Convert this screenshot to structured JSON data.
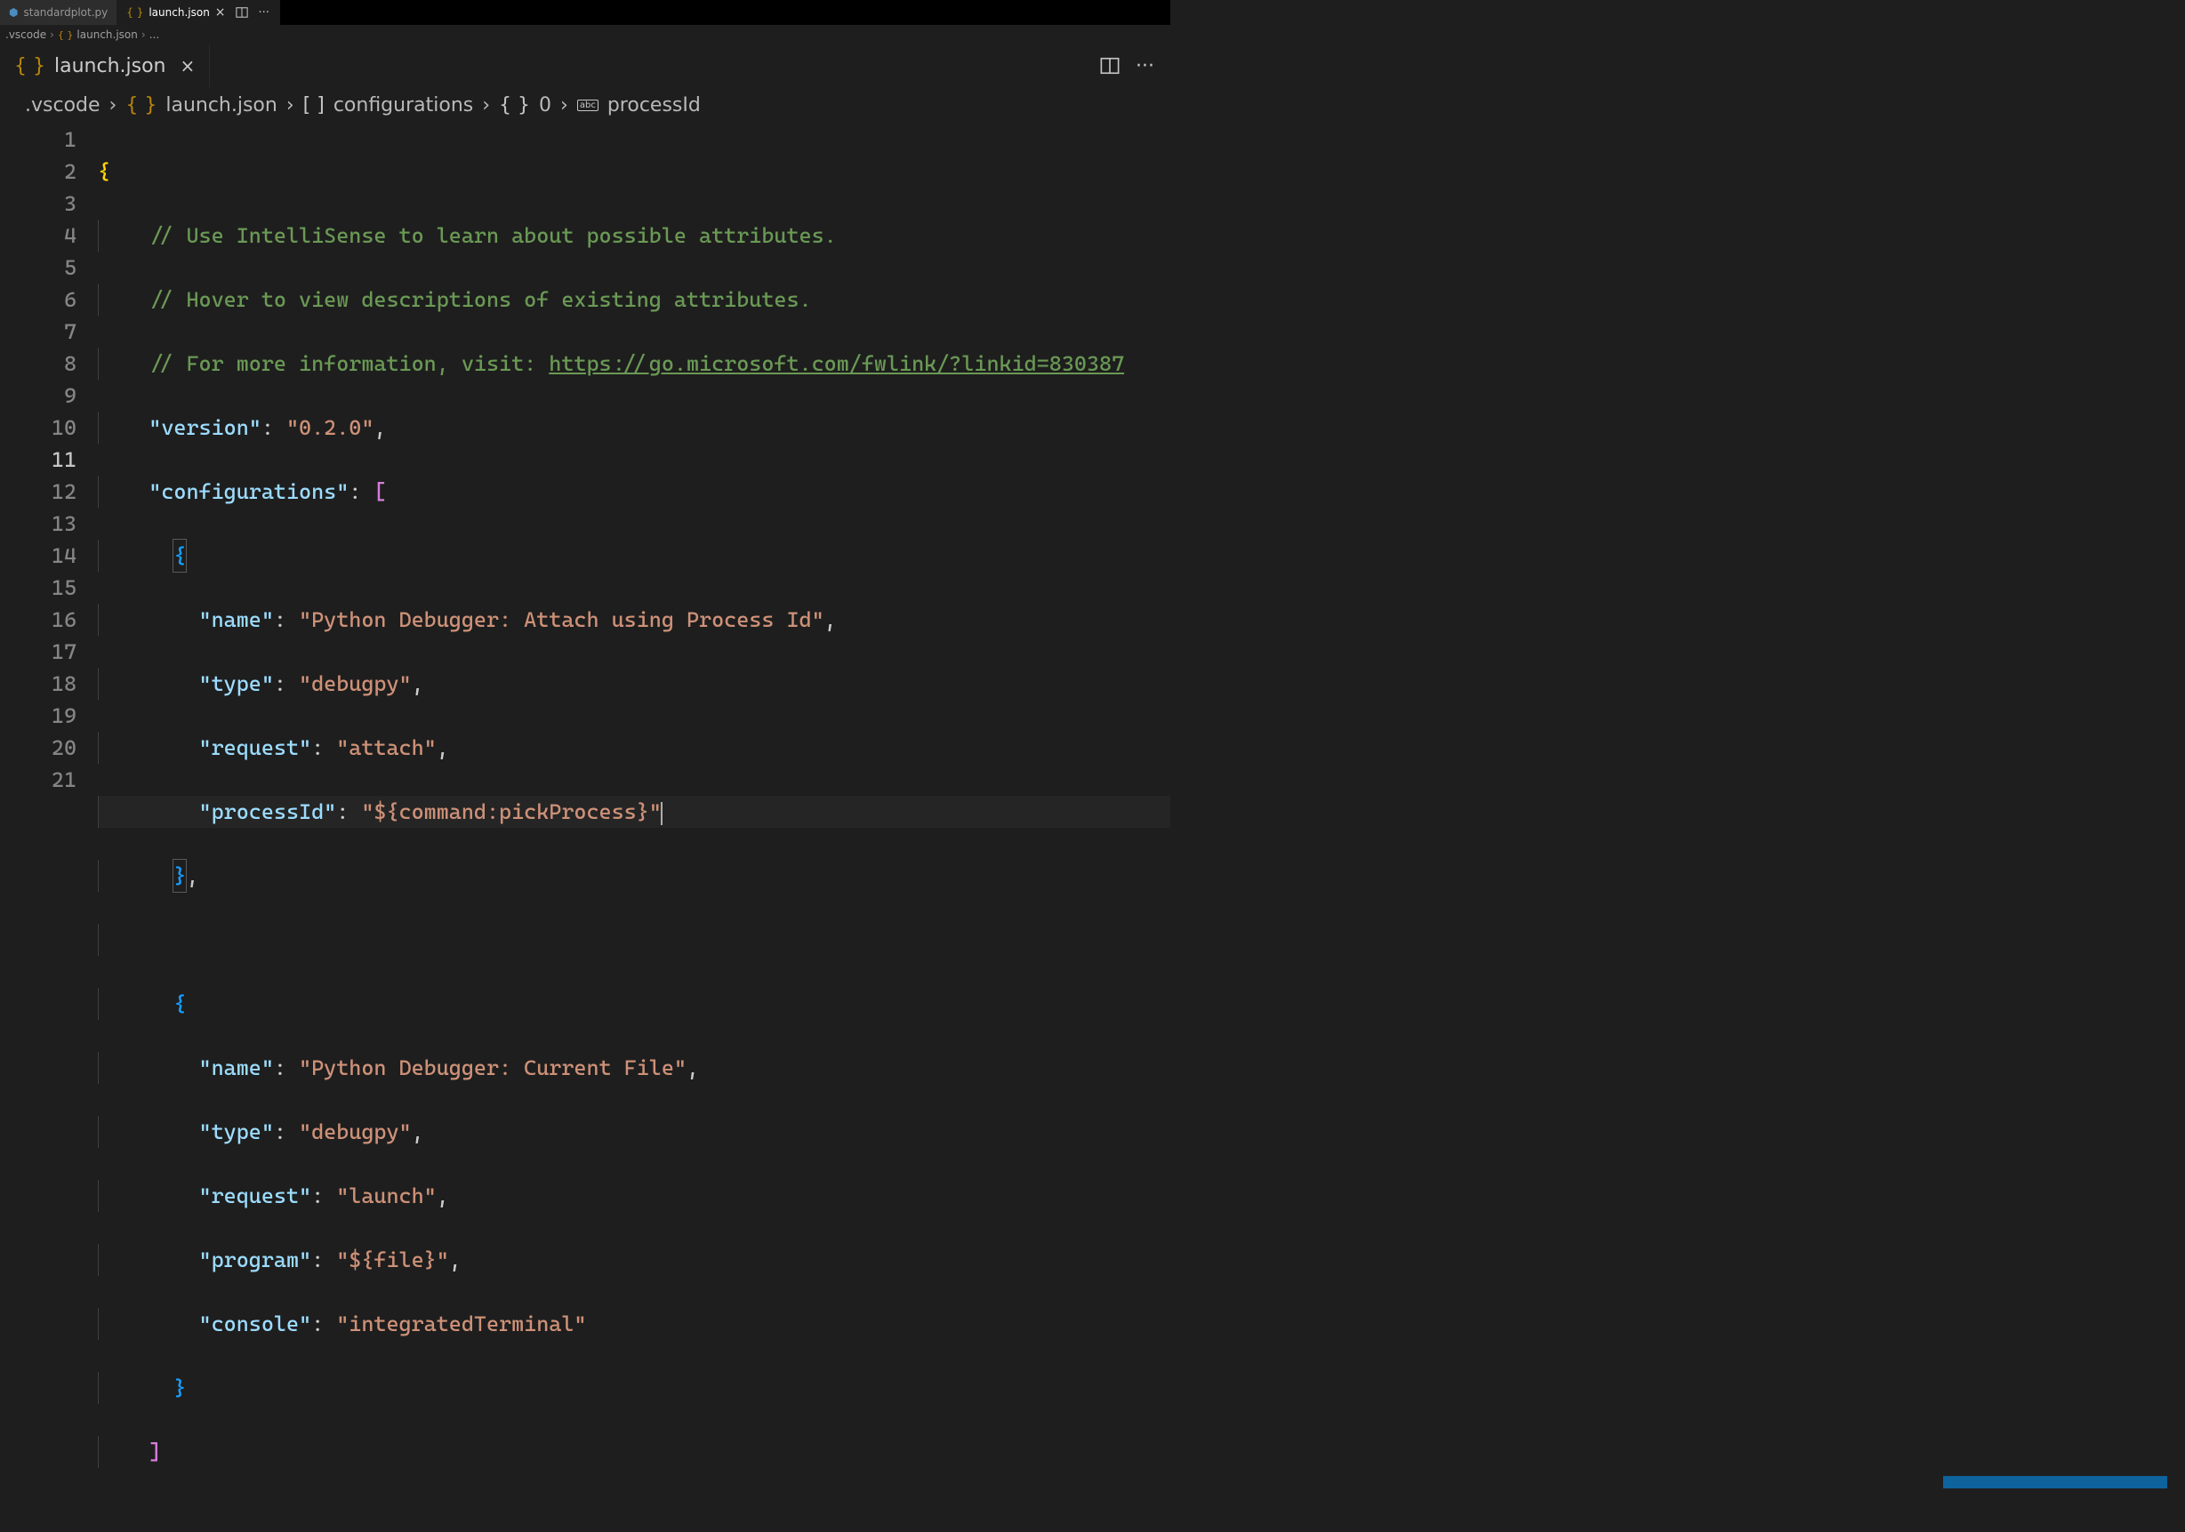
{
  "tabs": [
    {
      "icon": "python-icon",
      "label": "standardplot.py",
      "active": false
    },
    {
      "icon": "braces-icon",
      "label": "launch.json",
      "active": true
    }
  ],
  "miniBreadcrumb": {
    "folder": ".vscode",
    "file": "launch.json",
    "rest": "..."
  },
  "bigTab": {
    "icon": "braces-icon",
    "name": "launch.json"
  },
  "breadcrumb": {
    "folder": ".vscode",
    "file": "launch.json",
    "seg2": "configurations",
    "seg3": "0",
    "seg4": "processId"
  },
  "code": {
    "comment1": "// Use IntelliSense to learn about possible attributes.",
    "comment2": "// Hover to view descriptions of existing attributes.",
    "comment3a": "// For more information, visit: ",
    "comment3link": "https://go.microsoft.com/fwlink/?linkid=830387",
    "versionKey": "\"version\"",
    "versionVal": "\"0.2.0\"",
    "configurationsKey": "\"configurations\"",
    "cfg0": {
      "nameKey": "\"name\"",
      "nameVal": "\"Python Debugger: Attach using Process Id\"",
      "typeKey": "\"type\"",
      "typeVal": "\"debugpy\"",
      "requestKey": "\"request\"",
      "requestVal": "\"attach\"",
      "processIdKey": "\"processId\"",
      "processIdVal": "\"${command:pickProcess}\""
    },
    "cfg1": {
      "nameKey": "\"name\"",
      "nameVal": "\"Python Debugger: Current File\"",
      "typeKey": "\"type\"",
      "typeVal": "\"debugpy\"",
      "requestKey": "\"request\"",
      "requestVal": "\"launch\"",
      "programKey": "\"program\"",
      "programVal": "\"${file}\"",
      "consoleKey": "\"console\"",
      "consoleVal": "\"integratedTerminal\""
    }
  },
  "lineNumbers": [
    "1",
    "2",
    "3",
    "4",
    "5",
    "6",
    "7",
    "8",
    "9",
    "10",
    "11",
    "12",
    "13",
    "14",
    "15",
    "16",
    "17",
    "18",
    "19",
    "20",
    "21"
  ]
}
